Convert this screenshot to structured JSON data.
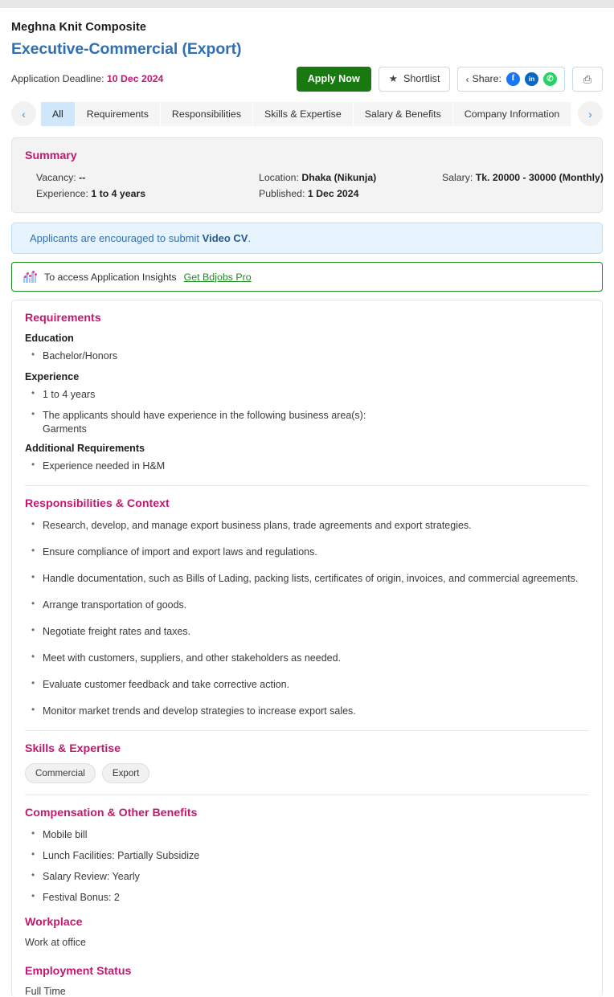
{
  "header": {
    "company": "Meghna Knit Composite",
    "job_title": "Executive-Commercial (Export)",
    "deadline_label": "Application Deadline:",
    "deadline_value": "10 Dec 2024",
    "title_color": "#2f6fb3",
    "accent_color": "#c2186f"
  },
  "actions": {
    "apply_label": "Apply Now",
    "shortlist_label": "Shortlist",
    "shortlist_icon": "star-icon",
    "share_label": "Share:",
    "share_icon": "share-icon",
    "socials": [
      {
        "name": "facebook-icon",
        "glyph": "f",
        "color": "#1877f2"
      },
      {
        "name": "linkedin-icon",
        "glyph": "in",
        "color": "#0a66c2"
      },
      {
        "name": "whatsapp-icon",
        "glyph": "✆",
        "color": "#25d366"
      }
    ],
    "print_icon": "printer-icon",
    "print_glyph": "⎙"
  },
  "tabs": {
    "prev_glyph": "‹",
    "next_glyph": "›",
    "items": [
      {
        "label": "All",
        "active": true
      },
      {
        "label": "Requirements",
        "active": false
      },
      {
        "label": "Responsibilities",
        "active": false
      },
      {
        "label": "Skills & Expertise",
        "active": false
      },
      {
        "label": "Salary & Benefits",
        "active": false
      },
      {
        "label": "Company Information",
        "active": false
      }
    ]
  },
  "summary": {
    "title": "Summary",
    "fields": [
      {
        "label": "Vacancy:",
        "value": "--"
      },
      {
        "label": "Location:",
        "value": "Dhaka (Nikunja)"
      },
      {
        "label": "Salary:",
        "value": "Tk. 20000 - 30000 (Monthly)"
      },
      {
        "label": "Experience:",
        "value": "1 to 4 years"
      },
      {
        "label": "Published:",
        "value": "1 Dec 2024"
      }
    ]
  },
  "video_cv": {
    "text_before": "Applicants are encouraged to submit ",
    "highlight": "Video CV",
    "text_after": "."
  },
  "insights": {
    "icon": "bar-chart-icon",
    "text": "To access Application Insights",
    "link": "Get Bdjobs Pro",
    "border_color": "#1f8a20"
  },
  "sections": {
    "requirements": {
      "title": "Requirements",
      "education_label": "Education",
      "education_items": [
        "Bachelor/Honors"
      ],
      "experience_label": "Experience",
      "experience_items": [
        "1 to 4 years",
        "The applicants should have experience in the following business area(s):"
      ],
      "experience_subline": "Garments",
      "additional_label": "Additional Requirements",
      "additional_items": [
        "Experience needed in H&M"
      ]
    },
    "responsibilities": {
      "title": "Responsibilities & Context",
      "items": [
        "Research, develop, and manage export business plans, trade agreements and export strategies.",
        "Ensure compliance of import and export laws and regulations.",
        "Handle documentation, such as Bills of Lading, packing lists, certificates of origin, invoices, and commercial agreements.",
        "Arrange transportation of goods.",
        "Negotiate freight rates and taxes.",
        "Meet with customers, suppliers, and other stakeholders as needed.",
        "Evaluate customer feedback and take corrective action.",
        "Monitor market trends and develop strategies to increase export sales."
      ]
    },
    "skills": {
      "title": "Skills & Expertise",
      "chips": [
        "Commercial",
        "Export"
      ]
    },
    "compensation": {
      "title": "Compensation & Other Benefits",
      "items": [
        "Mobile bill",
        "Lunch Facilities: Partially Subsidize",
        "Salary Review: Yearly",
        "Festival Bonus: 2"
      ]
    },
    "workplace": {
      "title": "Workplace",
      "text": "Work at office"
    },
    "employment": {
      "title": "Employment Status",
      "text": "Full Time"
    }
  }
}
